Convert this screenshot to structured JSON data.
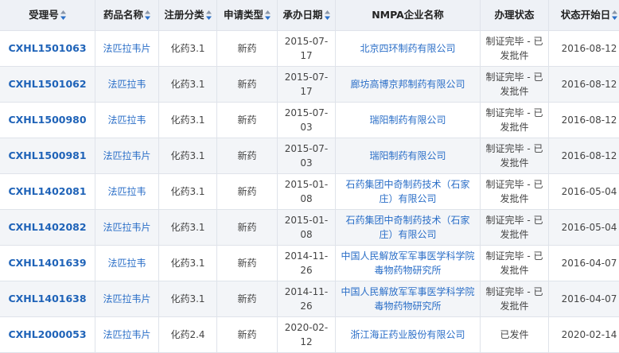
{
  "table": {
    "columns": [
      {
        "label": "受理号",
        "sortable": true
      },
      {
        "label": "药品名称",
        "sortable": true
      },
      {
        "label": "注册分类",
        "sortable": true
      },
      {
        "label": "申请类型",
        "sortable": true
      },
      {
        "label": "承办日期",
        "sortable": true
      },
      {
        "label": "NMPA企业名称",
        "sortable": false
      },
      {
        "label": "办理状态",
        "sortable": false
      },
      {
        "label": "状态开始日",
        "sortable": true
      }
    ],
    "rows": [
      {
        "id": "CXHL1501063",
        "drug": "法匹拉韦片",
        "category": "化药3.1",
        "type": "新药",
        "date": "2015-07-17",
        "company": "北京四环制药有限公司",
        "status": "制证完毕 - 已发批件",
        "start": "2016-08-12"
      },
      {
        "id": "CXHL1501062",
        "drug": "法匹拉韦",
        "category": "化药3.1",
        "type": "新药",
        "date": "2015-07-17",
        "company": "廊坊高博京邦制药有限公司",
        "status": "制证完毕 - 已发批件",
        "start": "2016-08-12"
      },
      {
        "id": "CXHL1500980",
        "drug": "法匹拉韦",
        "category": "化药3.1",
        "type": "新药",
        "date": "2015-07-03",
        "company": "瑞阳制药有限公司",
        "status": "制证完毕 - 已发批件",
        "start": "2016-08-12"
      },
      {
        "id": "CXHL1500981",
        "drug": "法匹拉韦片",
        "category": "化药3.1",
        "type": "新药",
        "date": "2015-07-03",
        "company": "瑞阳制药有限公司",
        "status": "制证完毕 - 已发批件",
        "start": "2016-08-12"
      },
      {
        "id": "CXHL1402081",
        "drug": "法匹拉韦",
        "category": "化药3.1",
        "type": "新药",
        "date": "2015-01-08",
        "company": "石药集团中奇制药技术（石家庄）有限公司",
        "status": "制证完毕 - 已发批件",
        "start": "2016-05-04"
      },
      {
        "id": "CXHL1402082",
        "drug": "法匹拉韦片",
        "category": "化药3.1",
        "type": "新药",
        "date": "2015-01-08",
        "company": "石药集团中奇制药技术（石家庄）有限公司",
        "status": "制证完毕 - 已发批件",
        "start": "2016-05-04"
      },
      {
        "id": "CXHL1401639",
        "drug": "法匹拉韦",
        "category": "化药3.1",
        "type": "新药",
        "date": "2014-11-26",
        "company": "中国人民解放军军事医学科学院毒物药物研究所",
        "status": "制证完毕 - 已发批件",
        "start": "2016-04-07"
      },
      {
        "id": "CXHL1401638",
        "drug": "法匹拉韦片",
        "category": "化药3.1",
        "type": "新药",
        "date": "2014-11-26",
        "company": "中国人民解放军军事医学科学院毒物药物研究所",
        "status": "制证完毕 - 已发批件",
        "start": "2016-04-07"
      },
      {
        "id": "CXHL2000053",
        "drug": "法匹拉韦片",
        "category": "化药2.4",
        "type": "新药",
        "date": "2020-02-12",
        "company": "浙江海正药业股份有限公司",
        "status": "已发件",
        "start": "2020-02-14"
      }
    ]
  },
  "colors": {
    "header_bg": "#eef1f6",
    "link": "#2a6ec7",
    "id_link": "#1f63b8",
    "sort_up": "#8a96a8",
    "sort_down": "#2a6ec7"
  }
}
